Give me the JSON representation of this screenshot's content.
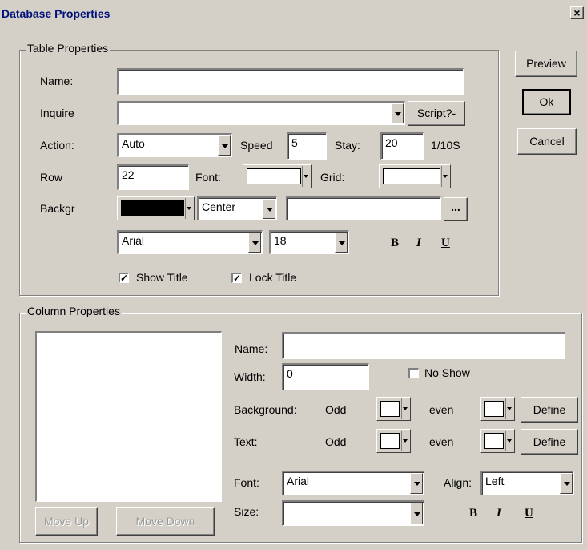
{
  "window": {
    "title": "Database Properties",
    "close_glyph": "×"
  },
  "side_buttons": {
    "preview": "Preview",
    "ok": "Ok",
    "cancel": "Cancel"
  },
  "table": {
    "legend": "Table Properties",
    "name_label": "Name:",
    "name_value": "",
    "inquire_label": "Inquire",
    "inquire_value": "",
    "script_button": "Script?-",
    "action_label": "Action:",
    "action_value": "Auto",
    "speed_label": "Speed",
    "speed_value": "5",
    "stay_label": "Stay:",
    "stay_value": "20",
    "stay_unit": "1/10S",
    "row_label": "Row",
    "row_value": "22",
    "font_label": "Font:",
    "grid_label": "Grid:",
    "backgr_label": "Backgr",
    "align_value": "Center",
    "image_path": "",
    "browse_button": "...",
    "font_family": "Arial",
    "font_size": "18",
    "bold": "B",
    "italic": "I",
    "underline": "U",
    "show_title_label": "Show Title",
    "lock_title_label": "Lock Title",
    "colors": {
      "font": "#ffffff",
      "grid": "#ffffff",
      "background": "#000000"
    }
  },
  "column": {
    "legend": "Column Properties",
    "move_up": "Move Up",
    "move_down": "Move Down",
    "name_label": "Name:",
    "name_value": "",
    "width_label": "Width:",
    "width_value": "0",
    "no_show_label": "No Show",
    "background_label": "Background:",
    "text_label": "Text:",
    "odd_label": "Odd",
    "even_label": "even",
    "define_button": "Define",
    "font_label": "Font:",
    "font_value": "Arial",
    "align_label": "Align:",
    "align_value": "Left",
    "size_label": "Size:",
    "size_value": "",
    "bold": "B",
    "italic": "I",
    "underline": "U"
  }
}
